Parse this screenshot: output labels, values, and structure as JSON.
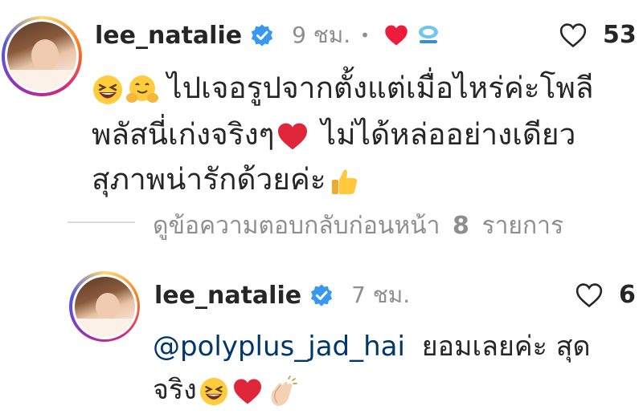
{
  "comment1": {
    "username": "lee_natalie",
    "time": "9 ชม.",
    "dot": "•",
    "like_count": "53",
    "line1": "ไปเจอรูปจากตั้งแต่เมื่อไหร่ค่ะโพลี",
    "line2a": "พลัสนี่เก่งจริงๆ",
    "line2b": "ไม่ได้หล่ออย่างเดียว",
    "line3": "สุภาพน่ารักด้วยค่ะ"
  },
  "view_replies": {
    "text": "ดูข้อความตอบกลับก่อนหน้า",
    "count": "8",
    "suffix": "รายการ"
  },
  "reply1": {
    "username": "lee_natalie",
    "time": "7 ชม.",
    "like_count": "6",
    "mention": "@polyplus_jad_hai",
    "text1": "ยอมเลยค่ะ สุด",
    "text2": "จริง"
  },
  "colors": {
    "verified": "#3897f0",
    "heart": "#ed4956",
    "mention": "#00376b",
    "meta": "#8e8e8e"
  },
  "icons": [
    "verified-icon",
    "heart-icon",
    "like-heart-icon",
    "laughing-emoji",
    "hug-emoji",
    "thumbs-up-emoji",
    "clapping-emoji",
    "sticker-icon"
  ]
}
